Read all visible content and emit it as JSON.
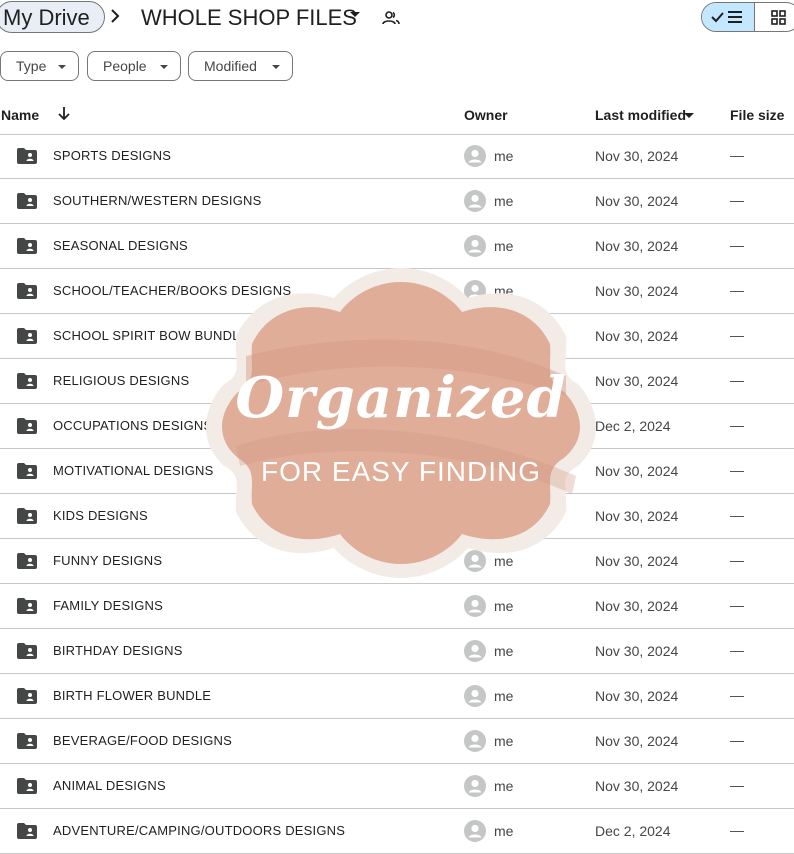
{
  "breadcrumb": {
    "root": "My Drive",
    "current": "WHOLE SHOP FILES"
  },
  "filters": [
    "Type",
    "People",
    "Modified"
  ],
  "columns": {
    "name": "Name",
    "owner": "Owner",
    "last_modified": "Last modified",
    "file_size": "File size"
  },
  "rows": [
    {
      "name": "SPORTS DESIGNS",
      "owner": "me",
      "modified": "Nov 30, 2024",
      "size": "—"
    },
    {
      "name": "SOUTHERN/WESTERN DESIGNS",
      "owner": "me",
      "modified": "Nov 30, 2024",
      "size": "—"
    },
    {
      "name": "SEASONAL DESIGNS",
      "owner": "me",
      "modified": "Nov 30, 2024",
      "size": "—"
    },
    {
      "name": "SCHOOL/TEACHER/BOOKS DESIGNS",
      "owner": "me",
      "modified": "Nov 30, 2024",
      "size": "—"
    },
    {
      "name": "SCHOOL SPIRIT BOW BUNDLE",
      "owner": "",
      "modified": "Nov 30, 2024",
      "size": "—"
    },
    {
      "name": "RELIGIOUS DESIGNS",
      "owner": "",
      "modified": "Nov 30, 2024",
      "size": "—"
    },
    {
      "name": "OCCUPATIONS DESIGNS",
      "owner": "",
      "modified": "Dec 2, 2024",
      "size": "—"
    },
    {
      "name": "MOTIVATIONAL DESIGNS",
      "owner": "",
      "modified": "Nov 30, 2024",
      "size": "—"
    },
    {
      "name": "KIDS DESIGNS",
      "owner": "",
      "modified": "Nov 30, 2024",
      "size": "—"
    },
    {
      "name": "FUNNY DESIGNS",
      "owner": "me",
      "modified": "Nov 30, 2024",
      "size": "—"
    },
    {
      "name": "FAMILY DESIGNS",
      "owner": "me",
      "modified": "Nov 30, 2024",
      "size": "—"
    },
    {
      "name": "BIRTHDAY DESIGNS",
      "owner": "me",
      "modified": "Nov 30, 2024",
      "size": "—"
    },
    {
      "name": "BIRTH FLOWER BUNDLE",
      "owner": "me",
      "modified": "Nov 30, 2024",
      "size": "—"
    },
    {
      "name": "BEVERAGE/FOOD DESIGNS",
      "owner": "me",
      "modified": "Nov 30, 2024",
      "size": "—"
    },
    {
      "name": "ANIMAL DESIGNS",
      "owner": "me",
      "modified": "Nov 30, 2024",
      "size": "—"
    },
    {
      "name": "ADVENTURE/CAMPING/OUTDOORS DESIGNS",
      "owner": "me",
      "modified": "Dec 2, 2024",
      "size": "—"
    }
  ],
  "overlay_badge": {
    "title": "Organized",
    "subtitle": "FOR EASY FINDING",
    "fill_color": "#dfad98",
    "border_color": "#f3ece6"
  },
  "icons": {
    "folder": "shared-folder-icon",
    "avatar": "default-avatar-icon",
    "view_list": "check-list-icon",
    "view_grid": "grid-icon",
    "share": "people-icon"
  },
  "colors": {
    "selected_view_bg": "#c2e7ff",
    "root_chip_bg": "#e9eef6",
    "divider": "#c7c7c7"
  }
}
